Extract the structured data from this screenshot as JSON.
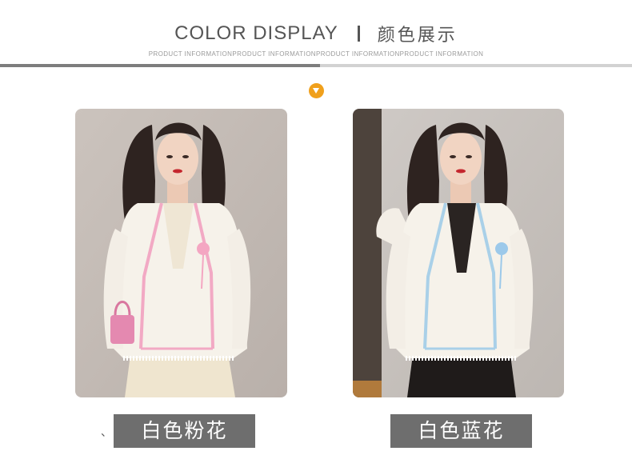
{
  "header": {
    "title_en": "COLOR DISPLAY",
    "separator": "I",
    "title_zh": "颜色展示",
    "subtitle": "PRODUCT INFORMATIONPRODUCT INFORMATIONPRODUCT INFORMATIONPRODUCT INFORMATION"
  },
  "colors": {
    "accent_orange": "#f0a01c",
    "rule_dark": "#7d7d7d",
    "rule_light": "#d2d2d2",
    "caption_bg": "#6e6e6e"
  },
  "products": [
    {
      "caption": "白色粉花",
      "trim_color": "#f2a9c4",
      "flower_color": "#f4a6c2"
    },
    {
      "caption": "白色蓝花",
      "trim_color": "#a9d0e8",
      "flower_color": "#9cc9ea"
    }
  ],
  "stray_mark": "、"
}
